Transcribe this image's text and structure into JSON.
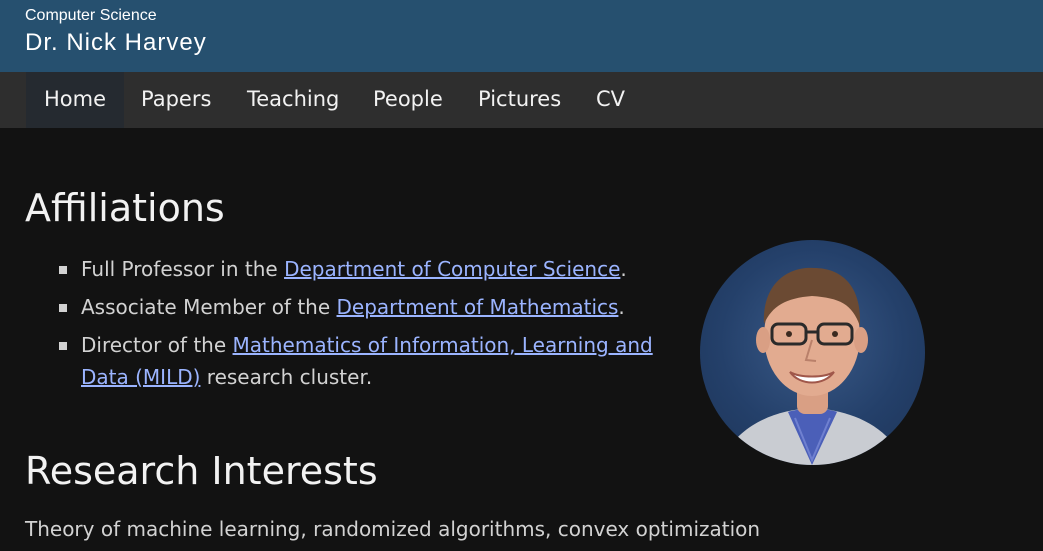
{
  "header": {
    "department": "Computer Science",
    "name": "Dr. Nick Harvey"
  },
  "nav": {
    "items": [
      {
        "label": "Home",
        "active": true
      },
      {
        "label": "Papers"
      },
      {
        "label": "Teaching"
      },
      {
        "label": "People"
      },
      {
        "label": "Pictures"
      },
      {
        "label": "CV"
      }
    ]
  },
  "affiliations": {
    "heading": "Affiliations",
    "items": [
      {
        "prefix": "Full Professor in the ",
        "link": "Department of Computer Science",
        "suffix": "."
      },
      {
        "prefix": "Associate Member of the ",
        "link": "Department of Mathematics",
        "suffix": "."
      },
      {
        "prefix": "Director of the ",
        "link": "Mathematics of Information, Learning and Data (MILD)",
        "suffix": " research cluster."
      }
    ]
  },
  "research": {
    "heading": "Research Interests",
    "text": "Theory of machine learning, randomized algorithms, convex optimization"
  },
  "colors": {
    "banner": "#26506f",
    "navbar": "#2e2e2e",
    "background": "#121212",
    "link": "#9bb4ff"
  },
  "photo": {
    "icon": "portrait-photo"
  }
}
